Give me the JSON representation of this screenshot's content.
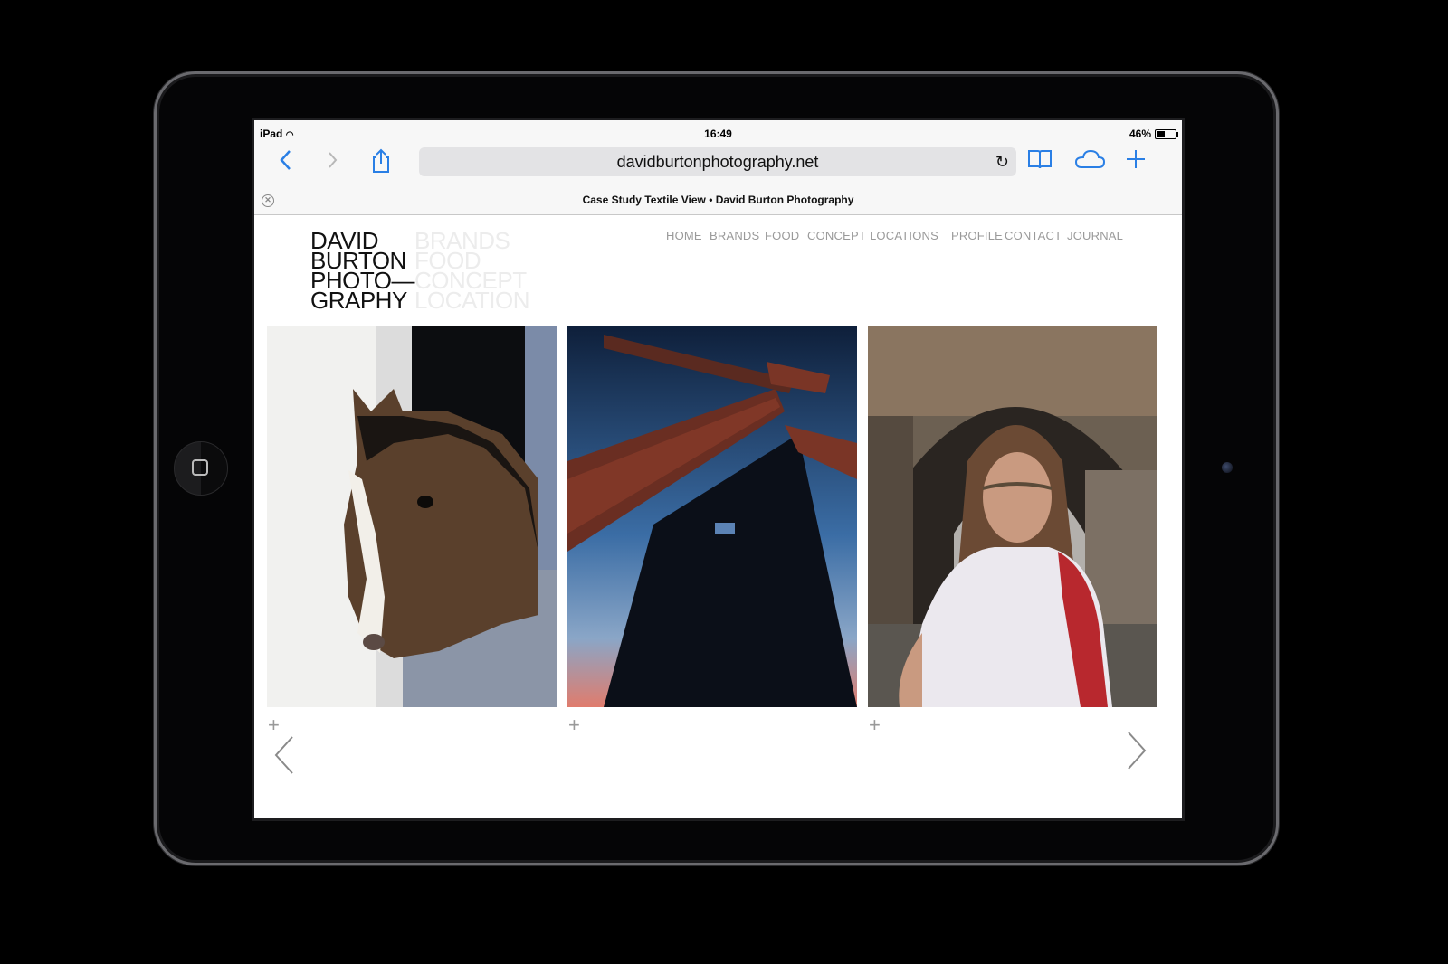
{
  "device": {
    "bezel_color": "#050506"
  },
  "status_bar": {
    "device": "iPad",
    "time": "16:49",
    "battery": "46%",
    "battery_level": 0.46
  },
  "browser": {
    "url": "davidburtonphotography.net",
    "tab_title": "Case Study Textile View • David Burton Photography",
    "accent": "#2a7fe5"
  },
  "site": {
    "logo_lines": [
      "DAVID",
      "BURTON",
      "PHOTO—",
      "GRAPHY"
    ],
    "logo_sub": [
      "BRANDS",
      "FOOD",
      "CONCEPT",
      "LOCATION"
    ],
    "menu": [
      "HOME",
      "BRANDS",
      "FOOD",
      "CONCEPT",
      "LOCATIONS",
      "PROFILE",
      "CONTACT",
      "JOURNAL"
    ],
    "photos": [
      "horse",
      "windmill",
      "girl"
    ]
  }
}
